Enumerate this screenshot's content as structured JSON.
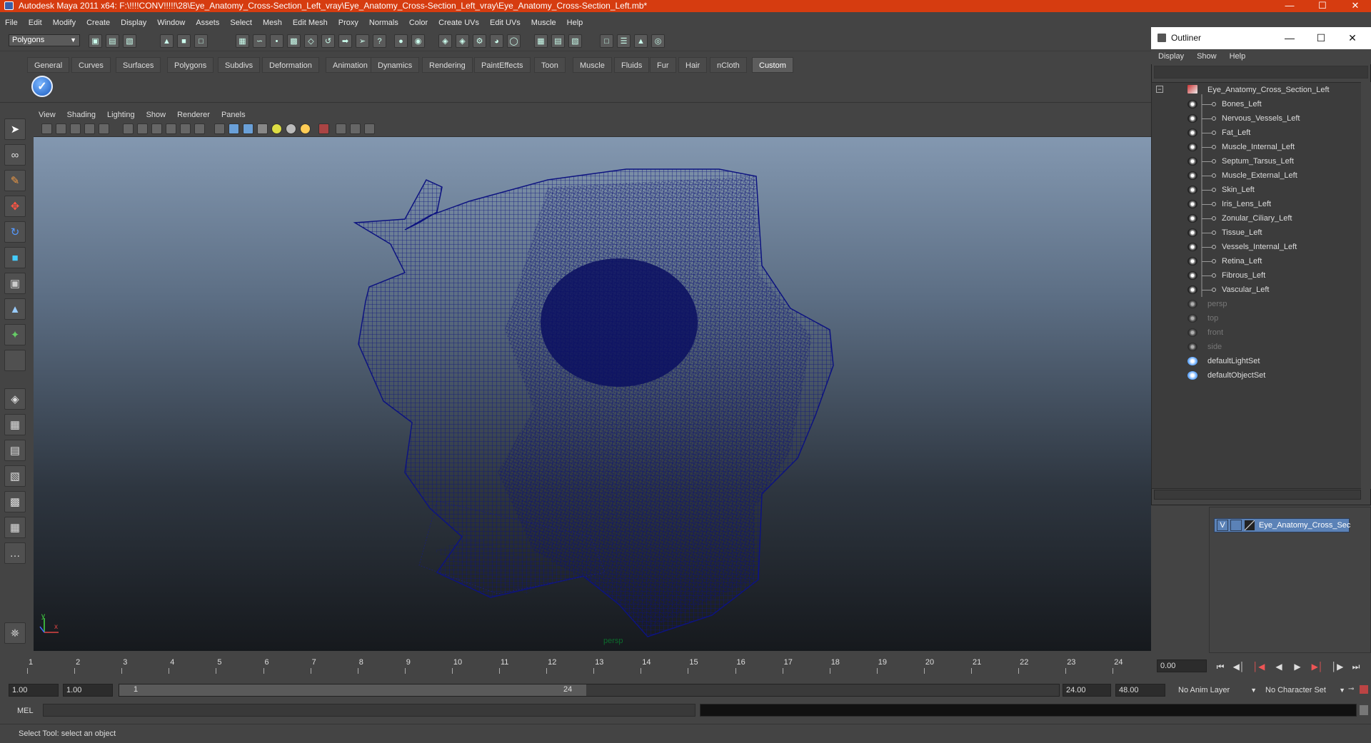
{
  "window": {
    "title": "Autodesk Maya 2011 x64: F:\\!!!!CONV!!!!!\\28\\Eye_Anatomy_Cross-Section_Left_vray\\Eye_Anatomy_Cross-Section_Left_vray\\Eye_Anatomy_Cross-Section_Left.mb*"
  },
  "menubar": [
    "File",
    "Edit",
    "Modify",
    "Create",
    "Display",
    "Window",
    "Assets",
    "Select",
    "Mesh",
    "Edit Mesh",
    "Proxy",
    "Normals",
    "Color",
    "Create UVs",
    "Edit UVs",
    "Muscle",
    "Help"
  ],
  "status": {
    "mode": "Polygons"
  },
  "shelf": {
    "tabs": [
      "General",
      "Curves",
      "Surfaces",
      "Polygons",
      "Subdivs",
      "Deformation",
      "Animation",
      "Dynamics",
      "Rendering",
      "PaintEffects",
      "Toon",
      "Muscle",
      "Fluids",
      "Fur",
      "Hair",
      "nCloth",
      "Custom"
    ],
    "active": "Custom"
  },
  "viewport": {
    "menu": [
      "View",
      "Shading",
      "Lighting",
      "Show",
      "Renderer",
      "Panels"
    ],
    "camera_label": "persp",
    "axis": {
      "y": "y",
      "x": "x"
    }
  },
  "outliner": {
    "title": "Outliner",
    "menu": [
      "Display",
      "Show",
      "Help"
    ],
    "root": "Eye_Anatomy_Cross_Section_Left",
    "children": [
      "Bones_Left",
      "Nervous_Vessels_Left",
      "Fat_Left",
      "Muscle_Internal_Left",
      "Septum_Tarsus_Left",
      "Muscle_External_Left",
      "Skin_Left",
      "Iris_Lens_Left",
      "Zonular_Ciliary_Left",
      "Tissue_Left",
      "Vessels_Internal_Left",
      "Retina_Left",
      "Fibrous_Left",
      "Vascular_Left"
    ],
    "cameras": [
      "persp",
      "top",
      "front",
      "side"
    ],
    "sets": [
      "defaultLightSet",
      "defaultObjectSet"
    ]
  },
  "layers": {
    "visible_flag": "V",
    "name": "Eye_Anatomy_Cross_Sec"
  },
  "timeline": {
    "ticks": [
      "1",
      "2",
      "3",
      "4",
      "5",
      "6",
      "7",
      "8",
      "9",
      "10",
      "11",
      "12",
      "13",
      "14",
      "15",
      "16",
      "17",
      "18",
      "19",
      "20",
      "21",
      "22",
      "23",
      "24"
    ],
    "current_time": "0.00"
  },
  "range": {
    "start": "1.00",
    "start2": "1.00",
    "slider_start": "1",
    "slider_end": "24",
    "end": "24.00",
    "end2": "48.00",
    "anim_layer": "No Anim Layer",
    "char_set": "No Character Set"
  },
  "command": {
    "label": "MEL"
  },
  "helpline": "Select Tool: select an object",
  "colors": {
    "title_bar": "#d63c10",
    "mesh_wire": "#0f1478",
    "layer_row": "#5b82b7"
  }
}
